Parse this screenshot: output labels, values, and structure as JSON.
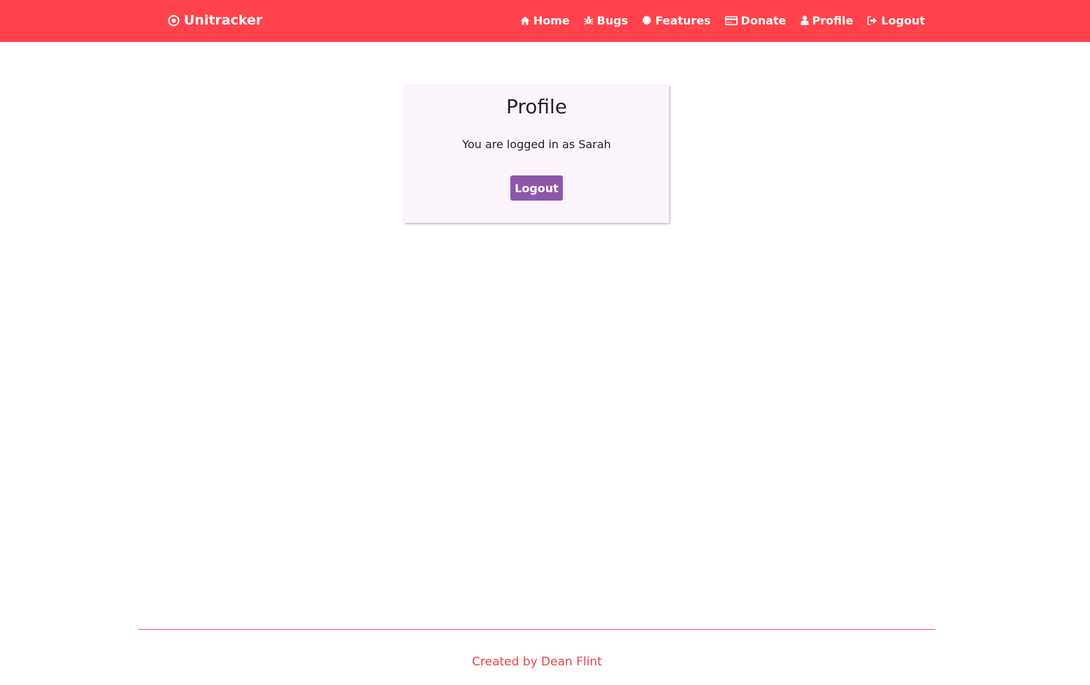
{
  "colors": {
    "navbar_bg": "#ff424b",
    "card_bg": "#fbf4fd",
    "button_bg": "#8e57a8",
    "footer_text": "#e8424d"
  },
  "brand": {
    "icon": "target-icon",
    "label": "Unitracker"
  },
  "nav": {
    "items": [
      {
        "icon": "home-icon",
        "label": "Home"
      },
      {
        "icon": "bug-icon",
        "label": "Bugs"
      },
      {
        "icon": "certificate-icon",
        "label": "Features"
      },
      {
        "icon": "credit-card-icon",
        "label": "Donate"
      },
      {
        "icon": "user-icon",
        "label": "Profile"
      },
      {
        "icon": "log-out-icon",
        "label": "Logout"
      }
    ]
  },
  "profile": {
    "title": "Profile",
    "message": "You are logged in as Sarah",
    "logout_label": "Logout"
  },
  "footer": {
    "text": "Created by Dean Flint"
  }
}
